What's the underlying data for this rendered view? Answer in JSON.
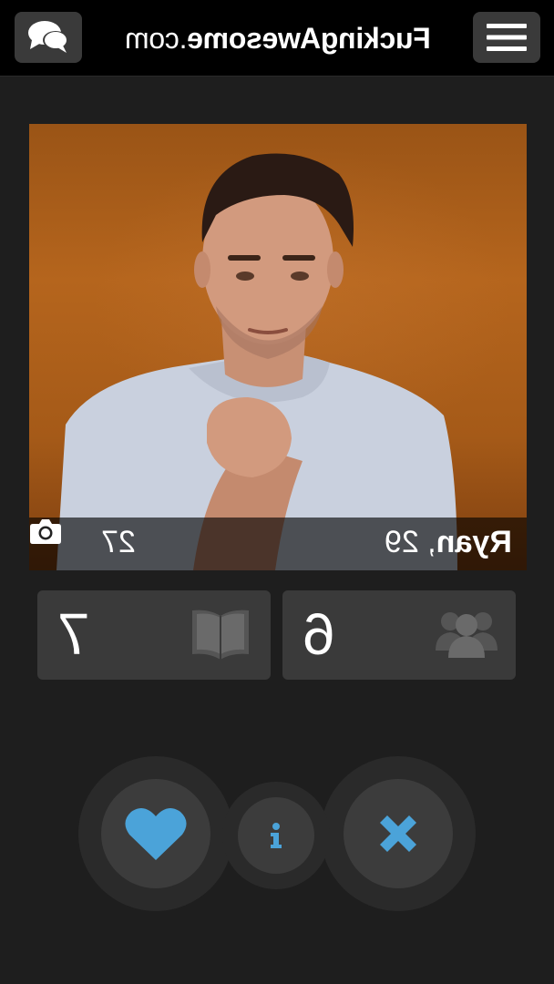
{
  "header": {
    "site_bold": "FuckingAwesome",
    "site_light": ".com",
    "chat_icon": "chat-bubbles-icon",
    "menu_icon": "hamburger-menu-icon"
  },
  "profile": {
    "name": "Ryan",
    "age_text": ", 29",
    "photo_count": "27",
    "camera_icon": "camera-icon"
  },
  "stats": {
    "books_count": "7",
    "books_icon": "open-book-icon",
    "friends_count": "6",
    "friends_icon": "group-icon"
  },
  "actions": {
    "like_icon": "heart-icon",
    "info_icon": "info-icon",
    "dismiss_icon": "x-icon",
    "accent_color": "#4ba3d9"
  }
}
